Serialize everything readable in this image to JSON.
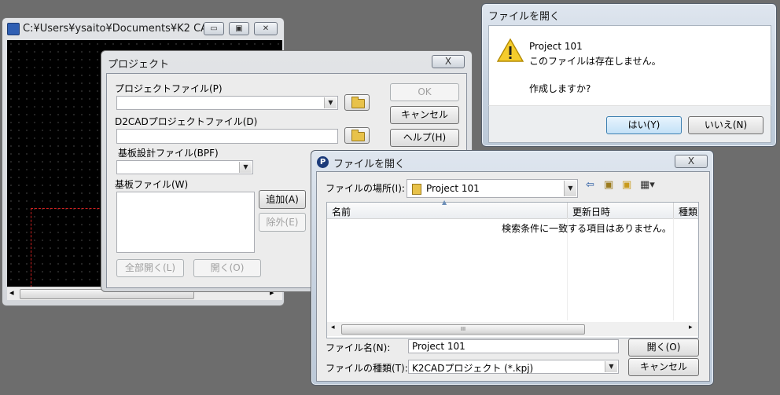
{
  "background_window": {
    "title": "C:¥Users¥ysaito¥Documents¥K2 CA...",
    "minimize_icon": "minimize-icon",
    "maximize_icon": "maximize-icon",
    "close_icon": "close-icon",
    "scroll_left": "◂",
    "scroll_right": "▸",
    "canvas_color": "#000000"
  },
  "project_dialog": {
    "title": "プロジェクト",
    "close_label": "X",
    "project_file_label": "プロジェクトファイル(P)",
    "project_file_value": "",
    "d2cad_label": "D2CADプロジェクトファイル(D)",
    "d2cad_value": "",
    "bpf_label": "基板設計ファイル(BPF)",
    "bpf_value": "",
    "board_files_label": "基板ファイル(W)",
    "ok_label": "OK",
    "cancel_label": "キャンセル",
    "help_label": "ヘルプ(H)",
    "add_label": "追加(A)",
    "remove_label": "除外(E)",
    "open_all_label": "全部開く(L)",
    "open_label": "開く(O)"
  },
  "alert_dialog": {
    "title": "ファイルを開く",
    "message_line1": "Project 101",
    "message_line2": "このファイルは存在しません。",
    "message_line3": "作成しますか?",
    "yes_label": "はい(Y)",
    "no_label": "いいえ(N)",
    "icon": "warning-icon"
  },
  "open_dialog": {
    "title": "ファイルを開く",
    "close_label": "X",
    "location_label": "ファイルの場所(I):",
    "location_value": "Project 101",
    "columns": [
      "名前",
      "更新日時",
      "種類"
    ],
    "empty_message": "検索条件に一致する項目はありません。",
    "scroll_grip": "III",
    "filename_label": "ファイル名(N):",
    "filename_value": "Project 101",
    "filetype_label": "ファイルの種類(T):",
    "filetype_value": "K2CADプロジェクト (*.kpj)",
    "open_label": "開く(O)",
    "cancel_label": "キャンセル",
    "toolbar_icons": [
      "back-icon",
      "up-folder-icon",
      "new-folder-icon",
      "view-menu-icon"
    ]
  }
}
